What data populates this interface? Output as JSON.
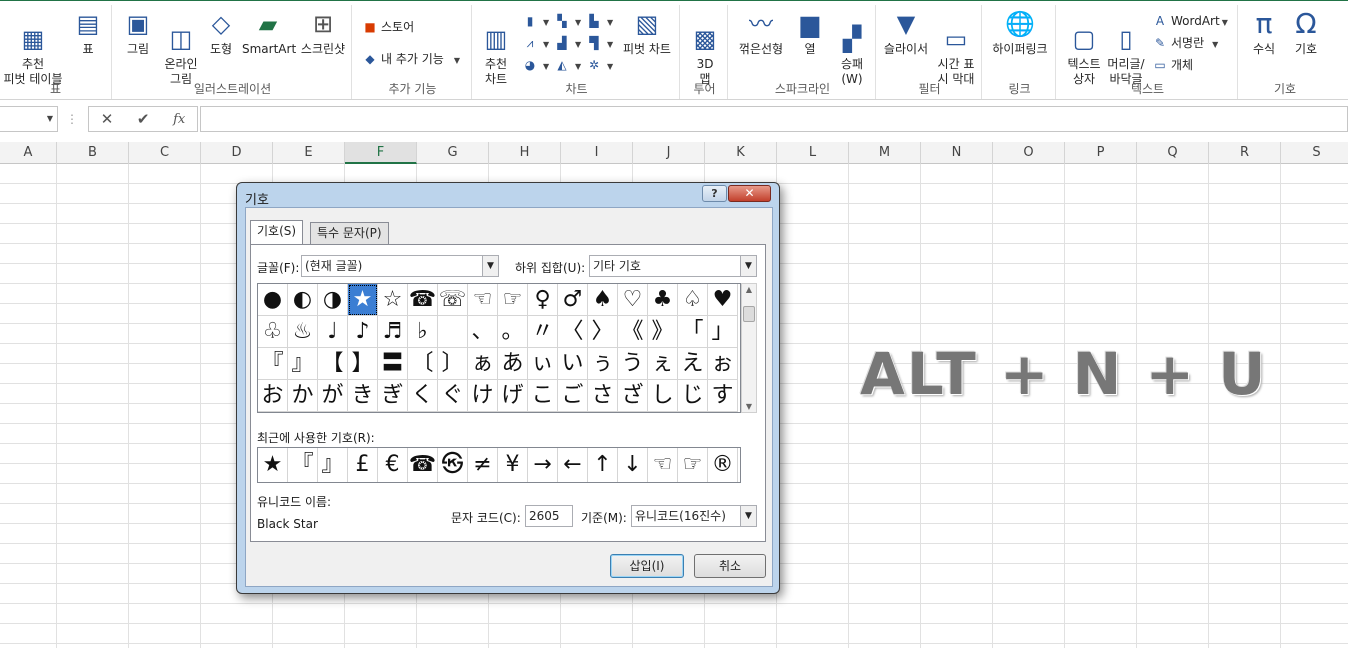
{
  "ribbon": {
    "groups": [
      {
        "label": "표",
        "buttons": [
          "추천\n피벗 테이블",
          "표"
        ]
      },
      {
        "label": "일러스트레이션",
        "buttons": [
          "그림",
          "온라인\n그림",
          "도형",
          "SmartArt",
          "스크린샷"
        ]
      },
      {
        "label": "추가 기능",
        "buttons": [
          "스토어",
          "내 추가 기능"
        ]
      },
      {
        "label": "차트",
        "buttons": [
          "추천\n차트",
          "피벗 차트"
        ]
      },
      {
        "label": "투어",
        "buttons": [
          "3D\n맵"
        ]
      },
      {
        "label": "스파크라인",
        "buttons": [
          "꺾은선형",
          "열",
          "승패\n(W)"
        ]
      },
      {
        "label": "필터",
        "buttons": [
          "슬라이서",
          "시간 표\n시 막대"
        ]
      },
      {
        "label": "링크",
        "buttons": [
          "하이퍼링크"
        ]
      },
      {
        "label": "텍스트",
        "buttons": [
          "텍스트\n상자",
          "머리글/\n바닥글",
          "WordArt",
          "서명란",
          "개체"
        ]
      },
      {
        "label": "기호",
        "buttons": [
          "수식",
          "기호"
        ]
      }
    ]
  },
  "formula_bar": {
    "name_box": "",
    "formula": "",
    "cancel_icon": "✕",
    "enter_icon": "✔",
    "fx_icon": "fx"
  },
  "columns": [
    "A",
    "B",
    "C",
    "D",
    "E",
    "F",
    "G",
    "H",
    "I",
    "J",
    "K",
    "L",
    "M",
    "N",
    "O",
    "P",
    "Q",
    "R",
    "S"
  ],
  "active_column": "F",
  "overlay": {
    "shortcut": "ALT + N + U"
  },
  "dialog": {
    "title": "기호",
    "help": "?",
    "close": "✕",
    "tabs": [
      "기호(S)",
      "특수 문자(P)"
    ],
    "font_label": "글꼴(F):",
    "font_value": "(현재 글꼴)",
    "subset_label": "하위 집합(U):",
    "subset_value": "기타 기호",
    "symbols": [
      "●",
      "◐",
      "◑",
      "★",
      "☆",
      "☎",
      "☏",
      "☜",
      "☞",
      "♀",
      "♂",
      "♠",
      "♡",
      "♣",
      "♤",
      "♥",
      "♧",
      "♨",
      "♩",
      "♪",
      "♬",
      "♭",
      "",
      "、",
      "。",
      "〃",
      "〈",
      "〉",
      "《",
      "》",
      "「",
      "」",
      "『",
      "』",
      "【",
      "】",
      "〓",
      "〔",
      "〕",
      "ぁ",
      "あ",
      "ぃ",
      "い",
      "ぅ",
      "う",
      "ぇ",
      "え",
      "ぉ",
      "お",
      "か",
      "が",
      "き",
      "ぎ",
      "く",
      "ぐ",
      "け",
      "げ",
      "こ",
      "ご",
      "さ",
      "ざ",
      "し",
      "じ",
      "す"
    ],
    "selected_index": 3,
    "recent_label": "최근에 사용한 기호(R):",
    "recent": [
      "★",
      "『",
      "』",
      "£",
      "€",
      "☎",
      "㉿",
      "≠",
      "¥",
      "→",
      "←",
      "↑",
      "↓",
      "☜",
      "☞",
      "®"
    ],
    "unicode_name_label": "유니코드 이름:",
    "unicode_name": "Black Star",
    "char_code_label": "문자 코드(C):",
    "char_code": "2605",
    "from_label": "기준(M):",
    "from_value": "유니코드(16진수)",
    "insert": "삽입(I)",
    "cancel": "취소"
  }
}
